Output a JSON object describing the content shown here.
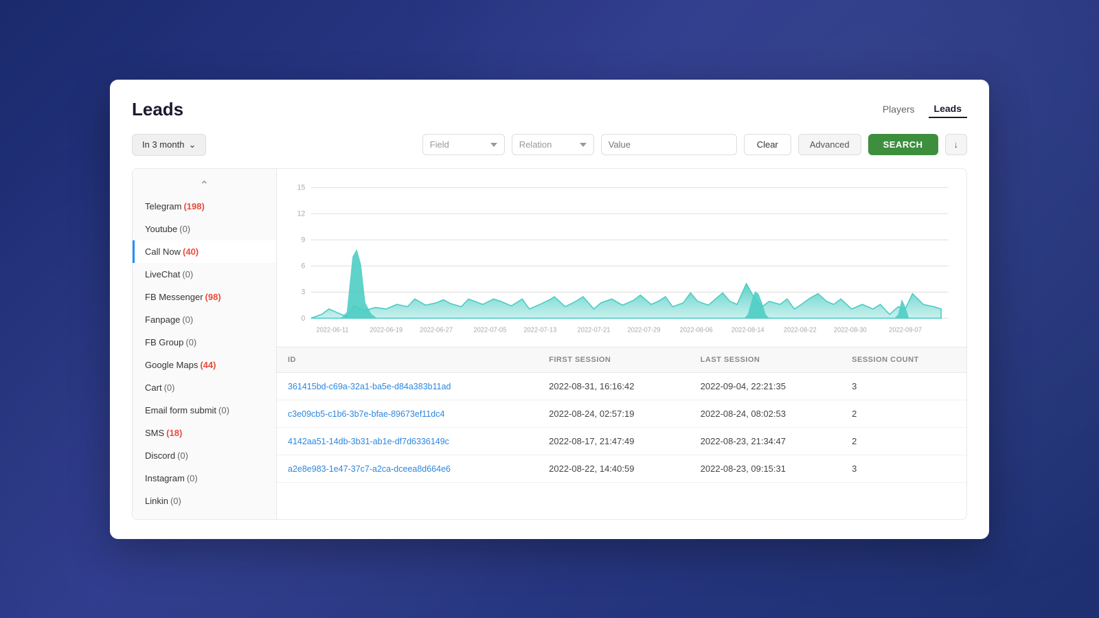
{
  "header": {
    "title": "Leads",
    "tabs": [
      {
        "label": "Players",
        "active": false
      },
      {
        "label": "Leads",
        "active": true
      }
    ]
  },
  "filter": {
    "period_label": "In 3 month",
    "field_placeholder": "Field",
    "relation_placeholder": "Relation",
    "value_placeholder": "Value",
    "clear_label": "Clear",
    "advanced_label": "Advanced",
    "search_label": "SEARCH",
    "download_icon": "↓"
  },
  "sidebar": {
    "items": [
      {
        "label": "Telegram",
        "count": "(198)",
        "highlight": true
      },
      {
        "label": "Youtube",
        "count": "(0)",
        "highlight": false
      },
      {
        "label": "Call Now",
        "count": "(40)",
        "highlight": true,
        "active": true
      },
      {
        "label": "LiveChat",
        "count": "(0)",
        "highlight": false
      },
      {
        "label": "FB Messenger",
        "count": "(98)",
        "highlight": true
      },
      {
        "label": "Fanpage",
        "count": "(0)",
        "highlight": false
      },
      {
        "label": "FB Group",
        "count": "(0)",
        "highlight": false
      },
      {
        "label": "Google Maps",
        "count": "(44)",
        "highlight": true
      },
      {
        "label": "Cart",
        "count": "(0)",
        "highlight": false
      },
      {
        "label": "Email form submit",
        "count": "(0)",
        "highlight": false
      },
      {
        "label": "SMS",
        "count": "(18)",
        "highlight": true
      },
      {
        "label": "Discord",
        "count": "(0)",
        "highlight": false
      },
      {
        "label": "Instagram",
        "count": "(0)",
        "highlight": false
      },
      {
        "label": "Linkin",
        "count": "(0)",
        "highlight": false
      }
    ]
  },
  "chart": {
    "x_labels": [
      "2022-06-11",
      "2022-06-19",
      "2022-06-27",
      "2022-07-05",
      "2022-07-13",
      "2022-07-21",
      "2022-07-29",
      "2022-08-06",
      "2022-08-14",
      "2022-08-22",
      "2022-08-30",
      "2022-09-07"
    ],
    "y_max": 15,
    "y_labels": [
      0,
      3,
      6,
      9,
      12,
      15
    ]
  },
  "table": {
    "columns": [
      "ID",
      "FIRST SESSION",
      "LAST SESSION",
      "SESSION COUNT"
    ],
    "rows": [
      {
        "id": "361415bd-c69a-32a1-ba5e-d84a383b11ad",
        "first_session": "2022-08-31, 16:16:42",
        "last_session": "2022-09-04, 22:21:35",
        "session_count": "3"
      },
      {
        "id": "c3e09cb5-c1b6-3b7e-bfae-89673ef11dc4",
        "first_session": "2022-08-24, 02:57:19",
        "last_session": "2022-08-24, 08:02:53",
        "session_count": "2"
      },
      {
        "id": "4142aa51-14db-3b31-ab1e-df7d6336149c",
        "first_session": "2022-08-17, 21:47:49",
        "last_session": "2022-08-23, 21:34:47",
        "session_count": "2"
      },
      {
        "id": "a2e8e983-1e47-37c7-a2ca-dceea8d664e6",
        "first_session": "2022-08-22, 14:40:59",
        "last_session": "2022-08-23, 09:15:31",
        "session_count": "3"
      }
    ]
  }
}
